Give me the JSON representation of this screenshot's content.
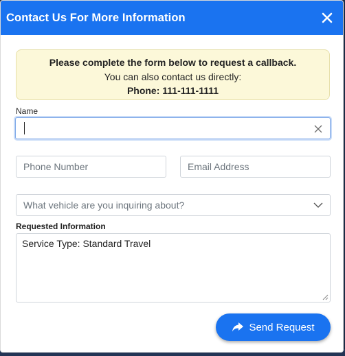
{
  "modal": {
    "title": "Contact Us For More Information",
    "close_icon": "close-icon"
  },
  "notice": {
    "line1": "Please complete the form below to request a callback.",
    "line2": "You can also contact us directly:",
    "line3": "Phone: 111-111-1111"
  },
  "form": {
    "name_label": "Name",
    "name_value": "",
    "phone_placeholder": "Phone Number",
    "email_placeholder": "Email Address",
    "vehicle_select": "What vehicle are you inquiring about?",
    "requested_label": "Requested Information",
    "requested_value": "Service Type: Standard Travel",
    "send_label": "Send Request",
    "send_icon": "share-arrow-icon"
  },
  "colors": {
    "primary": "#1a73f0",
    "notice_bg": "#fcf8d9"
  }
}
